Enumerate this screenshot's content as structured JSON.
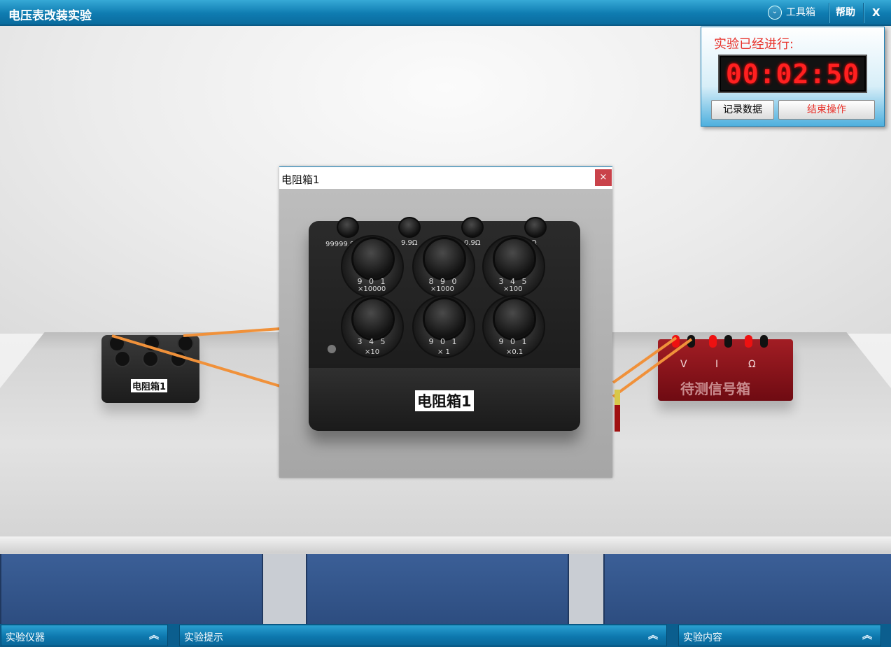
{
  "header": {
    "title": "电压表改装实验",
    "toolbox_label": "工具箱",
    "help_label": "帮助",
    "close_label": "X"
  },
  "timer": {
    "label": "实验已经进行:",
    "value": "00:02:50",
    "record_button": "记录数据",
    "end_button": "结束操作",
    "end_button_color": "#e8322b"
  },
  "scene": {
    "small_box_label": "电阻箱1",
    "signal_box": {
      "label": "待测信号箱",
      "terminals": [
        "V",
        "I",
        "Ω"
      ]
    },
    "wire_color": "#f0913a"
  },
  "popup": {
    "title": "电阻箱1",
    "close_label": "×",
    "box_label": "电阻箱1",
    "terminal_labels": [
      "99999.9Ω",
      "9.9Ω",
      "0.9Ω",
      "Ω"
    ],
    "dials": [
      {
        "digits": "9 0 1",
        "multiplier": "×10000"
      },
      {
        "digits": "8 9 0",
        "multiplier": "×1000"
      },
      {
        "digits": "3 4 5",
        "multiplier": "×100"
      },
      {
        "digits": "3 4 5",
        "multiplier": "×10"
      },
      {
        "digits": "9 0 1",
        "multiplier": "× 1"
      },
      {
        "digits": "9 0 1",
        "multiplier": "×0.1"
      }
    ]
  },
  "bottom_panels": {
    "instruments": "实验仪器",
    "hints": "实验提示",
    "content": "实验内容",
    "expand_icon": "double-chevron-up-icon"
  }
}
